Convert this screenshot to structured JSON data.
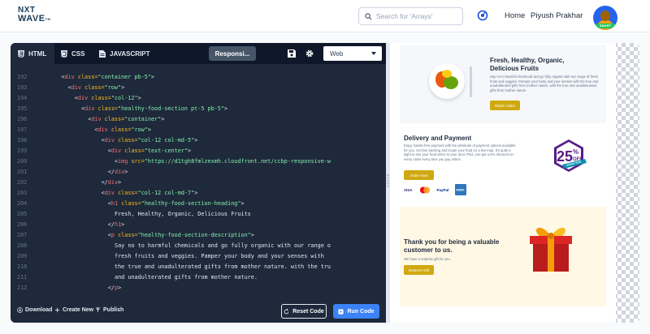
{
  "header": {
    "logo_line1": "NXT",
    "logo_line2": "WAVE",
    "logo_tm": "TM",
    "search_placeholder": "Search for 'Arrays'",
    "nav_home": "Home",
    "user_name": "Piyush Prakhar",
    "avatar_tag": "SMART"
  },
  "editor": {
    "tabs": [
      {
        "label": "HTML",
        "icon": "html5-icon"
      },
      {
        "label": "CSS",
        "icon": "css3-icon"
      },
      {
        "label": "JAVASCRIPT",
        "icon": "js-file-icon"
      }
    ],
    "responsive_label": "Responsi...",
    "view_select": "Web",
    "code_lines": [
      {
        "n": "192",
        "indent": 2,
        "parts": [
          [
            "br",
            "<"
          ],
          [
            "tag",
            "div "
          ],
          [
            "attr",
            "class="
          ],
          [
            "str",
            "\"container pb-5\""
          ],
          [
            "br",
            ">"
          ]
        ]
      },
      {
        "n": "193",
        "indent": 3,
        "parts": [
          [
            "br",
            "<"
          ],
          [
            "tag",
            "div "
          ],
          [
            "attr",
            "class="
          ],
          [
            "str",
            "\"row\""
          ],
          [
            "br",
            ">"
          ]
        ]
      },
      {
        "n": "194",
        "indent": 4,
        "parts": [
          [
            "br",
            "<"
          ],
          [
            "tag",
            "div "
          ],
          [
            "attr",
            "class="
          ],
          [
            "str",
            "\"col-12\""
          ],
          [
            "br",
            ">"
          ]
        ]
      },
      {
        "n": "195",
        "indent": 5,
        "parts": [
          [
            "br",
            "<"
          ],
          [
            "tag",
            "div "
          ],
          [
            "attr",
            "class="
          ],
          [
            "str",
            "\"healthy-food-section pt-5 pb-5\""
          ],
          [
            "br",
            ">"
          ]
        ]
      },
      {
        "n": "196",
        "indent": 6,
        "parts": [
          [
            "br",
            "<"
          ],
          [
            "tag",
            "div "
          ],
          [
            "attr",
            "class="
          ],
          [
            "str",
            "\"container\""
          ],
          [
            "br",
            ">"
          ]
        ]
      },
      {
        "n": "197",
        "indent": 7,
        "parts": [
          [
            "br",
            "<"
          ],
          [
            "tag",
            "div "
          ],
          [
            "attr",
            "class="
          ],
          [
            "str",
            "\"row\""
          ],
          [
            "br",
            ">"
          ]
        ]
      },
      {
        "n": "198",
        "indent": 8,
        "parts": [
          [
            "br",
            "<"
          ],
          [
            "tag",
            "div "
          ],
          [
            "attr",
            "class="
          ],
          [
            "str",
            "\"col-12 col-md-5\""
          ],
          [
            "br",
            ">"
          ]
        ]
      },
      {
        "n": "199",
        "indent": 9,
        "parts": [
          [
            "br",
            "<"
          ],
          [
            "tag",
            "div "
          ],
          [
            "attr",
            "class="
          ],
          [
            "str",
            "\"text-center\""
          ],
          [
            "br",
            ">"
          ]
        ]
      },
      {
        "n": "200",
        "indent": 10,
        "parts": [
          [
            "br",
            "<"
          ],
          [
            "tag",
            "img "
          ],
          [
            "attr",
            "src="
          ],
          [
            "str",
            "\"https://d1tgh8fmlzexmh.cloudfront.net/ccbp-responsive-w"
          ]
        ]
      },
      {
        "n": "201",
        "indent": 9,
        "parts": [
          [
            "br",
            "</"
          ],
          [
            "tag",
            "div"
          ],
          [
            "br",
            ">"
          ]
        ]
      },
      {
        "n": "202",
        "indent": 8,
        "parts": [
          [
            "br",
            "</"
          ],
          [
            "tag",
            "div"
          ],
          [
            "br",
            ">"
          ]
        ]
      },
      {
        "n": "203",
        "indent": 8,
        "parts": [
          [
            "br",
            "<"
          ],
          [
            "tag",
            "div "
          ],
          [
            "attr",
            "class="
          ],
          [
            "str",
            "\"col-12 col-md-7\""
          ],
          [
            "br",
            ">"
          ]
        ]
      },
      {
        "n": "204",
        "indent": 9,
        "parts": [
          [
            "br",
            "<"
          ],
          [
            "tag",
            "h1 "
          ],
          [
            "attr",
            "class="
          ],
          [
            "str",
            "\"healthy-food-section-heading\""
          ],
          [
            "br",
            ">"
          ]
        ]
      },
      {
        "n": "205",
        "indent": 10,
        "parts": [
          [
            "br",
            "Fresh, Healthy, Organic, Delicious Fruits"
          ]
        ]
      },
      {
        "n": "206",
        "indent": 9,
        "parts": [
          [
            "br",
            "</"
          ],
          [
            "tag",
            "h1"
          ],
          [
            "br",
            ">"
          ]
        ]
      },
      {
        "n": "207",
        "indent": 9,
        "parts": [
          [
            "br",
            "<"
          ],
          [
            "tag",
            "p "
          ],
          [
            "attr",
            "class="
          ],
          [
            "str",
            "\"healthy-food-section-description\""
          ],
          [
            "br",
            ">"
          ]
        ]
      },
      {
        "n": "208",
        "indent": 10,
        "parts": [
          [
            "br",
            "Say no to harmful chemicals and go fully organic with our range o"
          ]
        ]
      },
      {
        "n": "209",
        "indent": 10,
        "parts": [
          [
            "br",
            "fresh fruits and veggies. Pamper your body and your senses with"
          ]
        ]
      },
      {
        "n": "210",
        "indent": 10,
        "parts": [
          [
            "br",
            "the true and unadulterated gifts from mother nature. with the tru"
          ]
        ]
      },
      {
        "n": "211",
        "indent": 10,
        "parts": [
          [
            "br",
            "and unadulterated gifts from mother nature."
          ]
        ]
      },
      {
        "n": "212",
        "indent": 9,
        "parts": [
          [
            "br",
            "</"
          ],
          [
            "tag",
            "p"
          ],
          [
            "br",
            ">"
          ]
        ]
      }
    ],
    "footer": {
      "download": "Download",
      "create_new": "Create New",
      "publish": "Publish",
      "reset": "Reset Code",
      "run": "Run Code"
    }
  },
  "preview": {
    "section1": {
      "title": "Fresh, Healthy, Organic, Delicious Fruits",
      "desc": "Say no to harmful chemicals and go fully organic with our range of fresh fruits and veggies. Pamper your body and your senses with the true and unadulterated gifts from mother nature. with the true and unadulterated gifts from mother nature",
      "button": "Watch Video"
    },
    "section2": {
      "title": "Delivery and Payment",
      "desc": "Enjoy hassle-free payment with the plenitude of payment options available for you. Get live tracking and locate your food on a live map. It's quite a sight to see your food arrive to your door. Plus, you get a 5% discount on every order every time you pay online.",
      "button": "Order Now",
      "badge_big": "25",
      "badge_pct": "%",
      "badge_off": "OFF",
      "badge_ribbon": "ORDER NOW",
      "cards": [
        {
          "label": "VISA",
          "color": "#1a1f71"
        },
        {
          "label": "MC",
          "color": "#eb001b"
        },
        {
          "label": "PayPal",
          "color": "#003087"
        },
        {
          "label": "AMEX",
          "color": "#2e77bc"
        }
      ]
    },
    "section3": {
      "title": "Thank you for being a valuable customer to us.",
      "desc": "We have a surprise gift for you",
      "button": "Redeem Gift"
    }
  },
  "colors": {
    "accent_blue": "#3b82f6",
    "editor_bg": "#1e293b",
    "tab_bar": "#0f172a",
    "button_yellow": "#d0a80f"
  }
}
